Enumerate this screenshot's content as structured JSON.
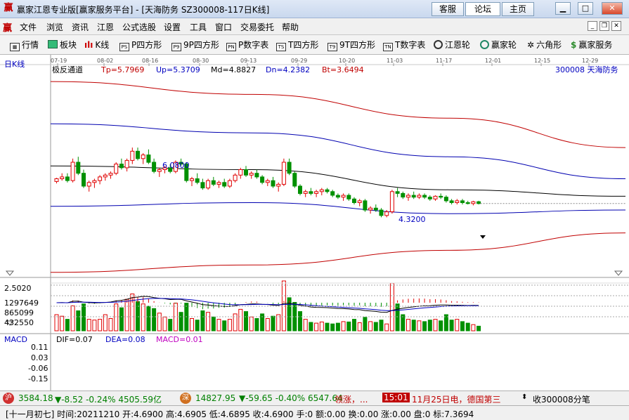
{
  "window": {
    "title": "赢家江恩专业版[赢家服务平台] - [天海防务  SZ300008-117日K线]",
    "tabs": [
      "客服",
      "论坛",
      "主页"
    ]
  },
  "menu": [
    "文件",
    "浏览",
    "资讯",
    "江恩",
    "公式选股",
    "设置",
    "工具",
    "窗口",
    "交易委托",
    "帮助"
  ],
  "toolbar": [
    {
      "label": "行情",
      "icon": "grid-icon"
    },
    {
      "label": "板块",
      "icon": "blocks-icon"
    },
    {
      "label": "K线",
      "icon": "candle-icon"
    },
    {
      "label": "P四方形",
      "icon": "ps-icon",
      "tag": "PS"
    },
    {
      "label": "9P四方形",
      "icon": "p9-icon",
      "tag": "P9"
    },
    {
      "label": "P数字表",
      "icon": "pn-icon",
      "tag": "PN"
    },
    {
      "label": "T四方形",
      "icon": "ts-icon",
      "tag": "TS"
    },
    {
      "label": "9T四方形",
      "icon": "t9-icon",
      "tag": "T9"
    },
    {
      "label": "T数字表",
      "icon": "tn-icon",
      "tag": "TN"
    },
    {
      "label": "江恩轮",
      "icon": "wheel-icon"
    },
    {
      "label": "赢家轮",
      "icon": "big-wheel-icon"
    },
    {
      "label": "六角形",
      "icon": "hexagon-icon"
    },
    {
      "label": "赢家服务",
      "icon": "dollar-icon"
    }
  ],
  "chart": {
    "period_label": "日K线",
    "indicator_name": "极反通道",
    "stats": {
      "tp": "Tp=5.7969",
      "up": "Up=5.3709",
      "md": "Md=4.8827",
      "dn": "Dn=4.2382",
      "bt": "Bt=3.6494"
    },
    "stock": "300008  天海防务",
    "high_marker": "6.0800",
    "low_marker": "4.3200",
    "date_ticks": [
      "07-19",
      "08-02",
      "08-16",
      "08-30",
      "09-13",
      "09-29",
      "10-20",
      "11-03",
      "11-17",
      "12-01",
      "12-15",
      "12-29"
    ],
    "price_axis_label": "2.5020",
    "volume_ticks": [
      "1297649",
      "865099",
      "432550"
    ],
    "colors": {
      "up": "#e00000",
      "down": "#009000",
      "channel_outer": "#c00000",
      "channel_inner": "#0000b0",
      "mid": "#000000"
    }
  },
  "chart_data": {
    "type": "candlestick",
    "volume_labels": [
      "1297649",
      "865099",
      "432550"
    ],
    "volume_max": 1297649,
    "candles": [
      [
        4.71,
        4.75,
        4.69,
        4.74,
        420000
      ],
      [
        4.74,
        4.8,
        4.72,
        4.76,
        380000
      ],
      [
        4.76,
        4.8,
        4.7,
        4.72,
        300000
      ],
      [
        4.72,
        4.96,
        4.7,
        4.92,
        650000
      ],
      [
        4.92,
        4.98,
        4.78,
        4.8,
        520000
      ],
      [
        4.8,
        4.84,
        4.64,
        4.66,
        700000
      ],
      [
        4.66,
        4.72,
        4.6,
        4.7,
        300000
      ],
      [
        4.7,
        4.74,
        4.64,
        4.72,
        280000
      ],
      [
        4.72,
        4.78,
        4.68,
        4.76,
        300000
      ],
      [
        4.76,
        4.8,
        4.72,
        4.78,
        420000
      ],
      [
        4.78,
        4.82,
        4.74,
        4.8,
        320000
      ],
      [
        4.8,
        4.92,
        4.78,
        4.9,
        700000
      ],
      [
        4.9,
        4.96,
        4.84,
        4.86,
        600000
      ],
      [
        4.86,
        4.96,
        4.82,
        4.94,
        820000
      ],
      [
        4.94,
        5.08,
        4.9,
        5.04,
        960000
      ],
      [
        5.04,
        5.08,
        4.94,
        4.96,
        760000
      ],
      [
        4.96,
        5.02,
        4.9,
        5.0,
        700000
      ],
      [
        5.0,
        5.06,
        4.9,
        4.92,
        640000
      ],
      [
        4.92,
        4.96,
        4.8,
        4.82,
        580000
      ],
      [
        4.82,
        4.86,
        4.76,
        4.84,
        460000
      ],
      [
        4.84,
        4.88,
        4.8,
        4.86,
        360000
      ],
      [
        4.86,
        4.9,
        4.8,
        4.82,
        300000
      ],
      [
        4.82,
        4.94,
        4.8,
        4.92,
        720000
      ],
      [
        4.92,
        4.96,
        4.88,
        4.9,
        480000
      ],
      [
        4.9,
        4.92,
        4.7,
        4.72,
        720000
      ],
      [
        4.72,
        4.76,
        4.66,
        4.74,
        320000
      ],
      [
        4.74,
        4.8,
        4.68,
        4.7,
        280000
      ],
      [
        4.7,
        4.74,
        4.62,
        4.64,
        520000
      ],
      [
        4.64,
        4.74,
        4.62,
        4.72,
        480000
      ],
      [
        4.72,
        4.76,
        4.66,
        4.68,
        360000
      ],
      [
        4.68,
        4.72,
        4.64,
        4.7,
        300000
      ],
      [
        4.7,
        4.74,
        4.64,
        4.66,
        260000
      ],
      [
        4.66,
        4.74,
        4.64,
        4.72,
        300000
      ],
      [
        4.72,
        4.8,
        4.7,
        4.78,
        440000
      ],
      [
        4.78,
        4.86,
        4.74,
        4.84,
        560000
      ],
      [
        4.84,
        4.88,
        4.76,
        4.78,
        500000
      ],
      [
        4.78,
        4.82,
        4.74,
        4.8,
        360000
      ],
      [
        4.8,
        4.84,
        4.74,
        4.76,
        320000
      ],
      [
        4.76,
        4.78,
        4.68,
        4.7,
        440000
      ],
      [
        4.7,
        4.74,
        4.66,
        4.72,
        320000
      ],
      [
        4.72,
        4.76,
        4.64,
        4.66,
        380000
      ],
      [
        4.66,
        4.7,
        4.6,
        4.68,
        420000
      ],
      [
        4.68,
        4.96,
        4.66,
        4.92,
        1297649
      ],
      [
        4.92,
        4.96,
        4.78,
        4.8,
        860000
      ],
      [
        4.8,
        4.82,
        4.64,
        4.66,
        740000
      ],
      [
        4.66,
        4.68,
        4.56,
        4.58,
        500000
      ],
      [
        4.58,
        4.62,
        4.54,
        4.6,
        300000
      ],
      [
        4.6,
        4.64,
        4.56,
        4.58,
        220000
      ],
      [
        4.58,
        4.62,
        4.54,
        4.6,
        200000
      ],
      [
        4.6,
        4.64,
        4.56,
        4.62,
        230000
      ],
      [
        4.62,
        4.64,
        4.58,
        4.6,
        200000
      ],
      [
        4.6,
        4.62,
        4.54,
        4.56,
        180000
      ],
      [
        4.56,
        4.58,
        4.52,
        4.54,
        200000
      ],
      [
        4.54,
        4.58,
        4.5,
        4.56,
        240000
      ],
      [
        4.56,
        4.58,
        4.5,
        4.52,
        230000
      ],
      [
        4.52,
        4.54,
        4.46,
        4.48,
        300000
      ],
      [
        4.48,
        4.52,
        4.44,
        4.5,
        210000
      ],
      [
        4.5,
        4.52,
        4.38,
        4.4,
        350000
      ],
      [
        4.4,
        4.44,
        4.36,
        4.42,
        240000
      ],
      [
        4.42,
        4.46,
        4.38,
        4.4,
        220000
      ],
      [
        4.4,
        4.42,
        4.32,
        4.34,
        280000
      ],
      [
        4.34,
        4.4,
        4.32,
        4.38,
        180000
      ],
      [
        4.38,
        4.62,
        4.36,
        4.6,
        1240000
      ],
      [
        4.6,
        4.64,
        4.54,
        4.58,
        700000
      ],
      [
        4.58,
        4.6,
        4.52,
        4.54,
        420000
      ],
      [
        4.54,
        4.58,
        4.5,
        4.56,
        300000
      ],
      [
        4.56,
        4.6,
        4.52,
        4.54,
        280000
      ],
      [
        4.54,
        4.58,
        4.52,
        4.56,
        260000
      ],
      [
        4.56,
        4.58,
        4.52,
        4.54,
        240000
      ],
      [
        4.54,
        4.56,
        4.5,
        4.52,
        280000
      ],
      [
        4.52,
        4.56,
        4.5,
        4.55,
        300000
      ],
      [
        4.55,
        4.58,
        4.52,
        4.54,
        260000
      ],
      [
        4.54,
        4.56,
        4.48,
        4.5,
        420000
      ],
      [
        4.5,
        4.52,
        4.46,
        4.48,
        280000
      ],
      [
        4.48,
        4.52,
        4.46,
        4.5,
        300000
      ],
      [
        4.5,
        4.52,
        4.46,
        4.48,
        240000
      ],
      [
        4.48,
        4.5,
        4.46,
        4.47,
        200000
      ],
      [
        4.47,
        4.5,
        4.45,
        4.49,
        160000
      ],
      [
        4.49,
        4.5,
        4.46,
        4.47,
        120000
      ]
    ],
    "channels": {
      "outer_upper": [
        5.8,
        5.66,
        5.4,
        5.08
      ],
      "inner_upper": [
        5.34,
        5.24,
        4.98,
        4.74
      ],
      "middle": [
        4.88,
        4.84,
        4.62,
        4.55
      ],
      "inner_lower": [
        4.44,
        4.48,
        4.36,
        4.4
      ],
      "outer_lower": [
        3.72,
        3.8,
        3.96,
        4.15
      ]
    },
    "macd": {
      "dif": "DIF=0.07",
      "dea": "DEA=0.08",
      "macd": "MACD=0.01",
      "ticks": [
        "0.11",
        "0.03",
        "-0.06",
        "-0.15"
      ]
    }
  },
  "macd_header": "MACD",
  "ticker": {
    "badge1": "沪",
    "index1": "3584.18",
    "change1": "▼-8.52 -0.24% 4505.59亿",
    "badge2": "深",
    "index2": "14827.95",
    "change2": "▼-59.65 -0.40% 6547.64",
    "news": "领涨，...",
    "time": "15:01",
    "headline": "11月25日电，德国第三",
    "receive": "收300008分笔"
  },
  "status": "[十一月初七] 时间:20211210 开:4.6900 高:4.6905 低:4.6895 收:4.6900 手:0 额:0.00 换:0.00 涨:0.00 盘:0 标:7.3694"
}
